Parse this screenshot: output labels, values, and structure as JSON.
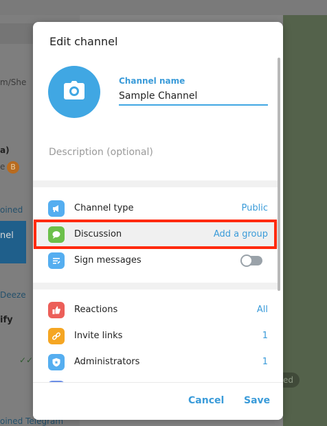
{
  "dialog": {
    "title": "Edit channel",
    "name_label": "Channel name",
    "name_value": "Sample Channel",
    "description_placeholder": "Description (optional)",
    "settings": [
      {
        "label": "Channel type",
        "value": "Public",
        "icon": "megaphone-icon",
        "color": "#55aef0"
      },
      {
        "label": "Discussion",
        "value": "Add a group",
        "icon": "chat-bubble-icon",
        "color": "#6cc04a"
      },
      {
        "label": "Sign messages",
        "icon": "signature-icon",
        "color": "#55aef0",
        "toggle_on": false
      }
    ],
    "manage": [
      {
        "label": "Reactions",
        "value": "All",
        "icon": "thumbs-up-icon",
        "color": "#ec5f59"
      },
      {
        "label": "Invite links",
        "value": "1",
        "icon": "link-icon",
        "color": "#f5a623"
      },
      {
        "label": "Administrators",
        "value": "1",
        "icon": "shield-icon",
        "color": "#55aef0"
      }
    ],
    "cancel_label": "Cancel",
    "save_label": "Save"
  },
  "background": {
    "texts": [
      "m/She",
      "a)",
      "e",
      "oined",
      "nel",
      "Deeze",
      "ify",
      "✓✓",
      "ed",
      "oined Telegram"
    ],
    "coin_symbol": "B"
  },
  "colors": {
    "accent": "#40a7e3",
    "link": "#3a9bd9",
    "highlight": "#ff2a0e"
  }
}
